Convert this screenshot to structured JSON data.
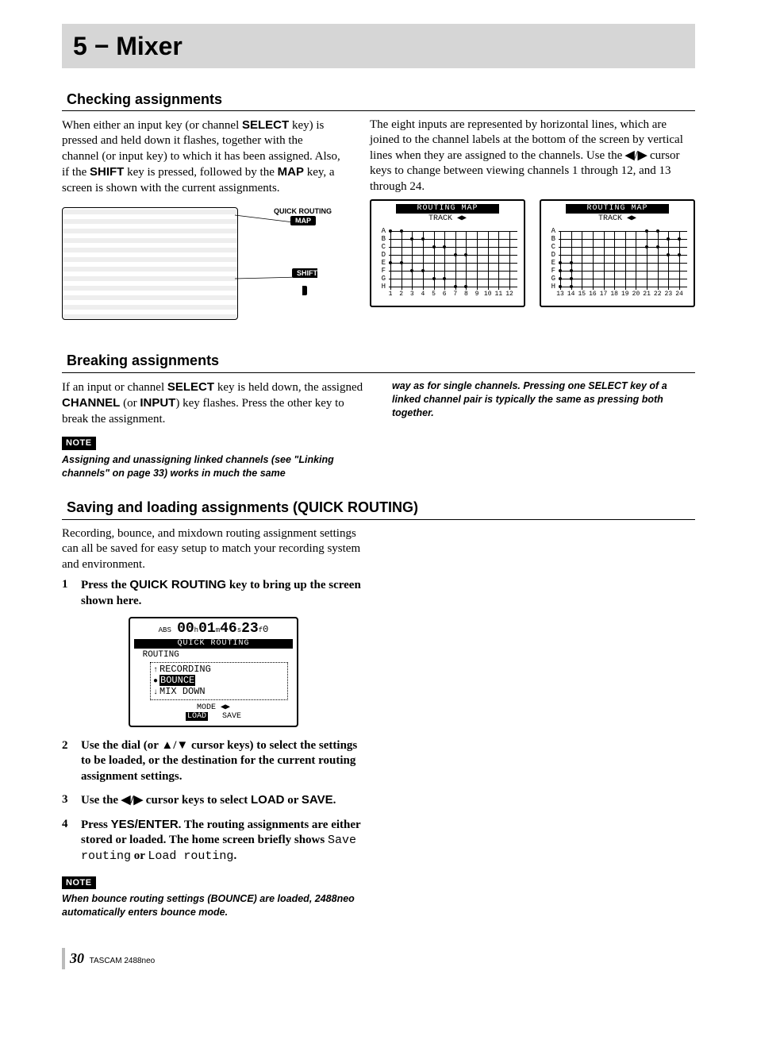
{
  "chapter_title": "5 − Mixer",
  "section1": {
    "heading": "Checking assignments",
    "left_html": "When either an input key (or channel <span class='bold-sans'>SELECT</span> key) is pressed and held down it flashes, together with the channel (or input key) to which it has been assigned. Also, if the <span class='bold-sans'>SHIFT</span> key is pressed, followed by the <span class='bold-sans'>MAP</span> key, a screen is shown with the current assignments.",
    "right_html": "The eight inputs are represented by horizontal lines, which are joined to the channel labels at the bottom of the screen by vertical lines when they are assigned to the channels. Use the <b>◀</b>/<b>▶</b> cursor keys to change between viewing channels 1 through 12, and 13 through 24.",
    "device_labels": {
      "qr": "QUICK ROUTING",
      "map": "MAP",
      "shift": "SHIFT"
    },
    "routing_title": "ROUTING MAP",
    "routing_sub": "TRACK ◀▶",
    "routing_rows": [
      "A",
      "B",
      "C",
      "D",
      "E",
      "F",
      "G",
      "H"
    ],
    "routing_cols_left": [
      "1",
      "2",
      "3",
      "4",
      "5",
      "6",
      "7",
      "8",
      "9",
      "10",
      "11",
      "12"
    ],
    "routing_cols_right": [
      "13",
      "14",
      "15",
      "16",
      "17",
      "18",
      "19",
      "20",
      "21",
      "22",
      "23",
      "24"
    ]
  },
  "section2": {
    "heading": "Breaking assignments",
    "left_html": "If an input or channel <span class='bold-sans'>SELECT</span> key is held down, the assigned <span class='bold-sans'>CHANNEL</span> (or <span class='bold-sans'>INPUT</span>) key flashes. Press the other key to break the assignment.",
    "note_label": "NOTE",
    "note_left": "Assigning and unassigning linked channels (see \"Linking channels\" on page 33) works in much the same",
    "note_right": "way as for single channels. Pressing one SELECT key of a linked channel pair is typically the same as pressing both together."
  },
  "section3": {
    "heading": "Saving and loading assignments (QUICK ROUTING)",
    "intro": "Recording, bounce, and mixdown routing assignment settings can all be saved for easy setup to match your recording system and environment.",
    "steps": [
      {
        "n": "1",
        "html": "Press the <span class='sans-key'>QUICK ROUTING</span> key to bring up the screen shown here."
      },
      {
        "n": "2",
        "html": "Use the dial (or ▲/▼ cursor keys) to select the settings to be loaded, or the destination for the current routing assignment settings."
      },
      {
        "n": "3",
        "html": "Use the ◀/▶ cursor keys to select <span class='sans-key'>LOAD</span> or <span class='sans-key'>SAVE</span>."
      },
      {
        "n": "4",
        "html": "Press <span class='sans-key'>YES/ENTER</span>. The routing assignments are either stored or loaded. The home screen briefly shows <span class='mono-inline'>Save routing</span> or <span class='mono-inline'>Load routing</span>."
      }
    ],
    "note_label": "NOTE",
    "note_body": "When bounce routing settings (BOUNCE) are loaded, 2488neo automatically enters bounce mode.",
    "qr_screen": {
      "time_prefix": "ABS",
      "time_main": "00h01m46s23f0",
      "title": "QUICK ROUTING",
      "routing_label": "ROUTING",
      "options": [
        "RECORDING",
        "BOUNCE",
        "MIX DOWN"
      ],
      "selected_index": 1,
      "mode_label": "MODE ◀▶",
      "load_label": "LOAD",
      "save_label": "SAVE"
    }
  },
  "footer": {
    "page_number": "30",
    "product": "TASCAM  2488neo"
  }
}
